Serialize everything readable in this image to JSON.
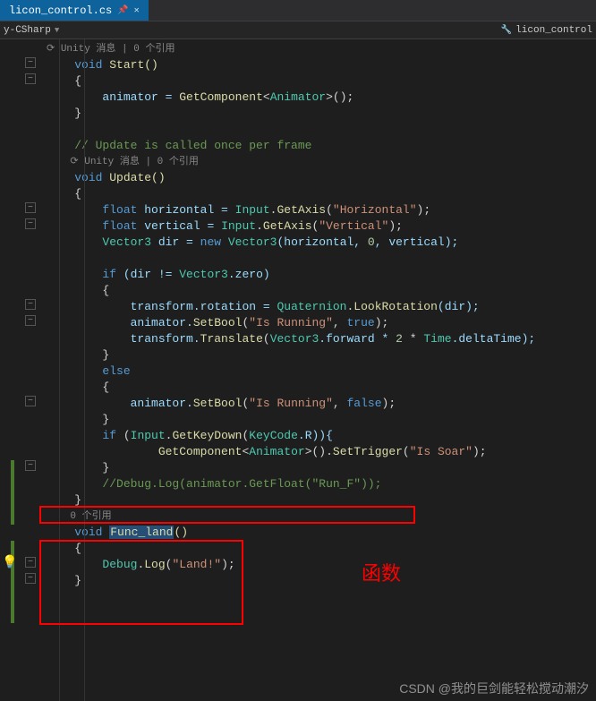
{
  "tab": {
    "filename": "licon_control.cs",
    "pin": "📌",
    "close": "✕"
  },
  "breadcrumb": {
    "left": "y-CSharp",
    "right_icon": "🔧",
    "right": "licon_control"
  },
  "codelens": {
    "start": "Unity 消息 | 0 个引用",
    "update": "Unity 消息 | 0 个引用",
    "func_land": "0 个引用"
  },
  "code": {
    "l1": "void",
    "l1b": " Start()",
    "l2": "{",
    "l3a": "    animator = ",
    "l3b": "GetComponent",
    "l3c": "<",
    "l3d": "Animator",
    "l3e": ">();",
    "l4": "}",
    "l5": "",
    "l6": "// Update is called once per frame",
    "l8a": "void",
    "l8b": " Update()",
    "l9": "{",
    "l10a": "    float",
    "l10b": " horizontal = ",
    "l10c": "Input",
    "l10d": ".",
    "l10e": "GetAxis",
    "l10f": "(",
    "l10g": "\"Horizontal\"",
    "l10h": ");",
    "l11a": "    float",
    "l11b": " vertical = ",
    "l11c": "Input",
    "l11d": ".",
    "l11e": "GetAxis",
    "l11f": "(",
    "l11g": "\"Vertical\"",
    "l11h": ");",
    "l12a": "    Vector3",
    "l12b": " dir = ",
    "l12c": "new",
    "l12d": " Vector3",
    "l12e": "(horizontal, ",
    "l12f": "0",
    "l12g": ", vertical);",
    "l13": "",
    "l14a": "    if",
    "l14b": " (dir != ",
    "l14c": "Vector3",
    "l14d": ".zero)",
    "l15": "    {",
    "l16a": "        transform.rotation = ",
    "l16b": "Quaternion",
    "l16c": ".",
    "l16d": "LookRotation",
    "l16e": "(dir);",
    "l17a": "        animator.",
    "l17b": "SetBool",
    "l17c": "(",
    "l17d": "\"Is Running\"",
    "l17e": ", ",
    "l17f": "true",
    "l17g": ");",
    "l18a": "        transform.",
    "l18b": "Translate",
    "l18c": "(",
    "l18d": "Vector3",
    "l18e": ".forward * ",
    "l18f": "2",
    "l18g": " * ",
    "l18h": "Time",
    "l18i": ".deltaTime);",
    "l19": "    }",
    "l20a": "    else",
    "l21": "    {",
    "l22a": "        animator.",
    "l22b": "SetBool",
    "l22c": "(",
    "l22d": "\"Is Running\"",
    "l22e": ", ",
    "l22f": "false",
    "l22g": ");",
    "l23": "    }",
    "l24a": "    if",
    "l24b": " (",
    "l24c": "Input",
    "l24d": ".",
    "l24e": "GetKeyDown",
    "l24f": "(",
    "l24g": "KeyCode",
    "l24h": ".R)){",
    "l25a": "        GetComponent",
    "l25b": "<",
    "l25c": "Animator",
    "l25d": ">().",
    "l25e": "SetTrigger",
    "l25f": "(",
    "l25g": "\"Is Soar\"",
    "l25h": ");",
    "l26": "    }",
    "l27": "    //Debug.Log(animator.GetFloat(\"Run_F\"));",
    "l28": "}",
    "l30a": "void",
    "l30b": " ",
    "l30c": "Func_land",
    "l30d": "()",
    "l31": "{",
    "l32a": "    Debug",
    "l32b": ".",
    "l32c": "Log",
    "l32d": "(",
    "l32e": "\"Land!\"",
    "l32f": ");",
    "l33": "}"
  },
  "annotation": "函数",
  "watermark": "CSDN @我的巨剑能轻松搅动潮汐"
}
